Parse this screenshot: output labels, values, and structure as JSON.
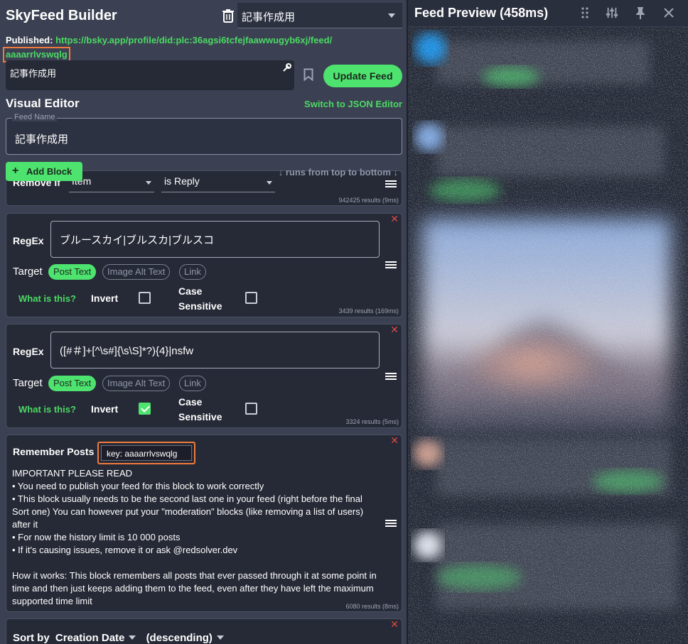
{
  "app": {
    "title": "SkyFeed Builder"
  },
  "feed_selector": {
    "value": "記事作成用"
  },
  "published": {
    "label": "Published:",
    "url": "https://bsky.app/profile/did:plc:36agsi6tcfejfaawwugyb6xj/feed/",
    "url_tail": "aaaarrlvswqlg"
  },
  "description": {
    "value": "記事作成用"
  },
  "update_button": {
    "label": "Update Feed"
  },
  "editor": {
    "title": "Visual Editor",
    "switch_label": "Switch to JSON Editor",
    "feed_name_label": "Feed Name",
    "feed_name_value": "記事作成用",
    "add_block_label": "Add Block",
    "runs_text": "↓ runs from top to bottom ↓"
  },
  "blocks": {
    "remove": {
      "prefix": "Remove if",
      "subject": "Item",
      "condition": "is Reply",
      "results": "942425 results (9ms)"
    },
    "regex1": {
      "label": "RegEx",
      "pattern": "ブルースカイ|ブルスカ|ブルスコ",
      "target_label": "Target",
      "targets": [
        "Post Text",
        "Image Alt Text",
        "Link"
      ],
      "what_label": "What is this?",
      "invert_label": "Invert",
      "invert_checked": false,
      "case_label_1": "Case",
      "case_label_2": "Sensitive",
      "case_checked": false,
      "results": "3439 results (169ms)"
    },
    "regex2": {
      "label": "RegEx",
      "pattern": "([#＃]+[^\\s#]{\\s\\S]*?){4}|nsfw",
      "target_label": "Target",
      "targets": [
        "Post Text",
        "Image Alt Text",
        "Link"
      ],
      "what_label": "What is this?",
      "invert_label": "Invert",
      "invert_checked": true,
      "case_label_1": "Case",
      "case_label_2": "Sensitive",
      "case_checked": false,
      "results": "3324 results (5ms)"
    },
    "remember": {
      "title": "Remember Posts",
      "key": "key: aaaarrlvswqlg",
      "lines": [
        "IMPORTANT PLEASE READ",
        "• You need to publish your feed for this block to work correctly",
        "• This block usually needs to be the second last one in your feed (right before the final Sort one) You can however put your \"moderation\" blocks (like removing a list of users) after it",
        "• For now the history limit is 10 000 posts",
        "• If it's causing issues, remove it or ask @redsolver.dev"
      ],
      "how_it_works": "How it works: This block remembers all posts that ever passed through it at some point in time and then just keeps adding them to the feed, even after they have left the maximum supported time limit",
      "results": "6080 results (8ms)"
    },
    "sort": {
      "prefix": "Sort by",
      "field": "Creation Date",
      "order": "(descending)"
    }
  },
  "preview": {
    "title": "Feed Preview (458ms)"
  },
  "icons": [
    "trash-icon",
    "wrench-icon",
    "bookmark-icon",
    "plus-icon",
    "drag-handle-icon",
    "close-icon",
    "grip-icon",
    "sliders-icon",
    "pin-icon"
  ],
  "colors": {
    "accent": "#4ee26f",
    "highlight": "#f07a3c",
    "danger": "#e04848"
  }
}
